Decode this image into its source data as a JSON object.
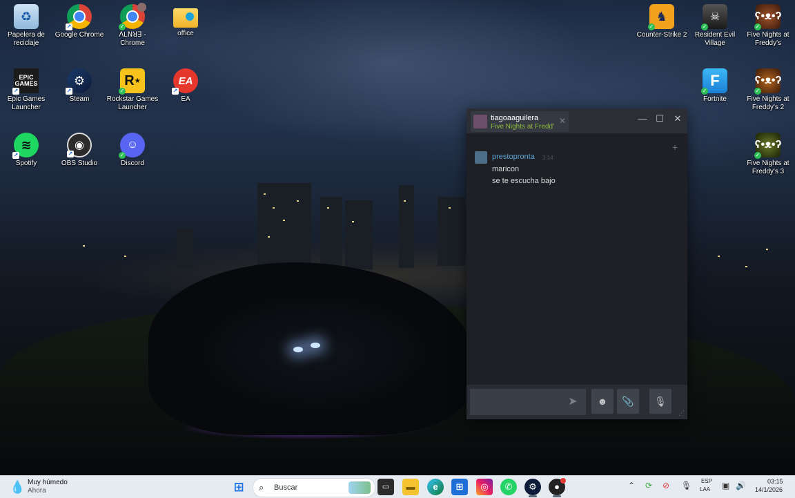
{
  "desktop": {
    "icons_left": [
      {
        "label": "Papelera de reciclaje",
        "icon": "recycle-bin-icon"
      },
      {
        "label": "Google Chrome",
        "icon": "chrome-icon"
      },
      {
        "label": "ꓥLꓠꓤꓱ - Chrome",
        "icon": "chrome-profile-icon"
      },
      {
        "label": "office",
        "icon": "folder-icon"
      },
      {
        "label": "Epic Games Launcher",
        "icon": "epic-games-icon"
      },
      {
        "label": "Steam",
        "icon": "steam-icon"
      },
      {
        "label": "Rockstar Games Launcher",
        "icon": "rockstar-icon"
      },
      {
        "label": "EA",
        "icon": "ea-icon"
      },
      {
        "label": "Spotify",
        "icon": "spotify-icon"
      },
      {
        "label": "OBS Studio",
        "icon": "obs-icon"
      },
      {
        "label": "Discord",
        "icon": "discord-icon"
      }
    ],
    "icons_right": [
      {
        "label": "Counter-Strike 2",
        "icon": "counter-strike-icon"
      },
      {
        "label": "Resident Evil Village",
        "icon": "resident-evil-icon"
      },
      {
        "label": "Five Nights at Freddy's",
        "icon": "fnaf-icon"
      },
      {
        "label": "Fortnite",
        "icon": "fortnite-icon"
      },
      {
        "label": "Five Nights at Freddy's 2",
        "icon": "fnaf2-icon"
      },
      {
        "label": "Five Nights at Freddy's 3",
        "icon": "fnaf3-icon"
      }
    ]
  },
  "chat": {
    "tab": {
      "name": "tiagoaaguilera",
      "game": "Five Nights at Fredd'"
    },
    "messages": [
      {
        "sender": "prestopronta",
        "time": "3:14",
        "lines": [
          "maricon",
          "se te escucha bajo"
        ]
      }
    ],
    "icons": {
      "add": "+",
      "send": "➤",
      "emoji": "☻",
      "attach": "📎",
      "voice": "🎙",
      "resize": "⋰"
    }
  },
  "taskbar": {
    "weather": {
      "title": "Muy húmedo",
      "subtitle": "Ahora"
    },
    "search_placeholder": "Buscar",
    "tray": {
      "lang1": "ESP",
      "lang2": "LAA",
      "time": "03:15",
      "date": "14/1/2026"
    }
  },
  "colors": {
    "steam_green": "#90ba3c",
    "steam_blue": "#5ba6d6",
    "taskbar": "#e6ebf1"
  }
}
